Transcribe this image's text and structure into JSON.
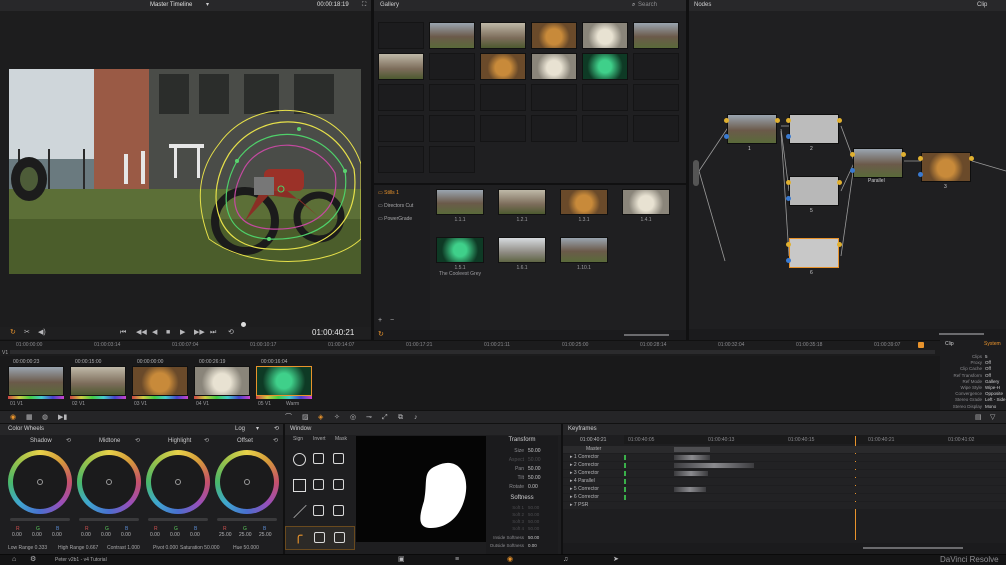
{
  "viewer": {
    "timeline_name": "Master Timeline",
    "timecode_top": "00:00:18:19",
    "timecode_main": "01:00:40:21"
  },
  "gallery": {
    "title": "Gallery",
    "search_placeholder": "Search",
    "albums": [
      "Stills 1",
      "Directors Cut",
      "PowerGrade"
    ],
    "stills": [
      {
        "label": "1.1.1"
      },
      {
        "label": "1.2.1"
      },
      {
        "label": "1.3.1"
      },
      {
        "label": "1.4.1"
      },
      {
        "label": "1.5.1",
        "sub": "The Cooleest Grey"
      },
      {
        "label": "1.6.1"
      },
      {
        "label": "1.10.1"
      }
    ]
  },
  "nodes": {
    "title": "Nodes",
    "mode": "Clip",
    "labels": [
      "1",
      "2",
      "3",
      "4",
      "5",
      "6"
    ],
    "parallel_label": "Parallel"
  },
  "timeline": {
    "ruler": [
      "01:00:00:00",
      "01:00:03:14",
      "01:00:07:04",
      "01:00:10:17",
      "01:00:14:07",
      "01:00:17:21",
      "01:00:21:11",
      "01:00:25:00",
      "01:00:28:14",
      "01:00:32:04",
      "01:00:35:18",
      "01:00:39:07"
    ],
    "track": "V1",
    "clips": [
      {
        "tc": "00:00:00:23",
        "name": "01 V1"
      },
      {
        "tc": "00:00:15:00",
        "name": "02 V1"
      },
      {
        "tc": "00:00:00:00",
        "name": "03 V1"
      },
      {
        "tc": "00:00:26:19",
        "name": "04 V1"
      },
      {
        "tc": "00:00:16:04",
        "name": "05 V1",
        "sub": "Warm"
      }
    ]
  },
  "clip_info": {
    "tabs": [
      "Clip",
      "System"
    ],
    "rows": [
      [
        "Clips",
        "5"
      ],
      [
        "Proxy",
        "Off"
      ],
      [
        "Clip Cache",
        "Off"
      ],
      [
        "Ref Transform",
        "Off"
      ],
      [
        "Ref Mode",
        "Gallery"
      ],
      [
        "Wipe Style",
        "Wipe-H"
      ],
      [
        "Convergence",
        "Opposite"
      ],
      [
        "Stereo Grade",
        "Left - Side"
      ],
      [
        "Stereo Display",
        "Mono"
      ]
    ]
  },
  "color_wheels": {
    "title": "Color Wheels",
    "mode": "Log",
    "wheels": [
      {
        "name": "Shadow",
        "vals": [
          "0.00",
          "0.00",
          "0.00"
        ]
      },
      {
        "name": "Midtone",
        "vals": [
          "0.00",
          "0.00",
          "0.00"
        ]
      },
      {
        "name": "Highlight",
        "vals": [
          "0.00",
          "0.00",
          "0.00"
        ]
      },
      {
        "name": "Offset",
        "vals": [
          "25.00",
          "25.00",
          "25.00"
        ]
      }
    ],
    "channels": [
      "R",
      "G",
      "B"
    ],
    "footer": [
      "Low Range 0.333",
      "High Range 0.667",
      "Contrast 1.000",
      "Pivot 0.000",
      "Saturation 50.000",
      "Hue 50.000"
    ]
  },
  "window": {
    "title": "Window",
    "cols": [
      "Sign",
      "Invert",
      "Mask"
    ]
  },
  "transform": {
    "title": "Transform",
    "rows": [
      [
        "Size",
        "50.00"
      ],
      [
        "Aspect",
        "50.00"
      ],
      [
        "Pan",
        "50.00"
      ],
      [
        "Tilt",
        "50.00"
      ],
      [
        "Rotate",
        "0.00"
      ]
    ],
    "softness_title": "Softness",
    "soft_rows": [
      [
        "Soft 1",
        "50.00"
      ],
      [
        "Soft 2",
        "50.00"
      ],
      [
        "Soft 3",
        "50.00"
      ],
      [
        "Soft 4",
        "50.00"
      ]
    ],
    "footer": [
      [
        "Inside Softness",
        "50.00"
      ],
      [
        "Outside Softness",
        "0.00"
      ]
    ]
  },
  "keyframes": {
    "title": "Keyframes",
    "tc": "01:00:40:21",
    "ruler": [
      "01:00:40:05",
      "01:00:40:13",
      "01:00:40:15",
      "01:00:40:21",
      "01:00:41:02"
    ],
    "rows": [
      "Master",
      "1  Corrector",
      "2  Corrector",
      "3  Corrector",
      "4  Parallel",
      "5  Corrector",
      "6  Corrector",
      "7  PSR"
    ]
  },
  "bottom": {
    "project": "Peter v2b1 - v4 Tutorial",
    "brand": "DaVinci Resolve"
  },
  "colors": {
    "accent": "#e8932c",
    "panel": "#222224",
    "bg": "#1a1a1b"
  }
}
